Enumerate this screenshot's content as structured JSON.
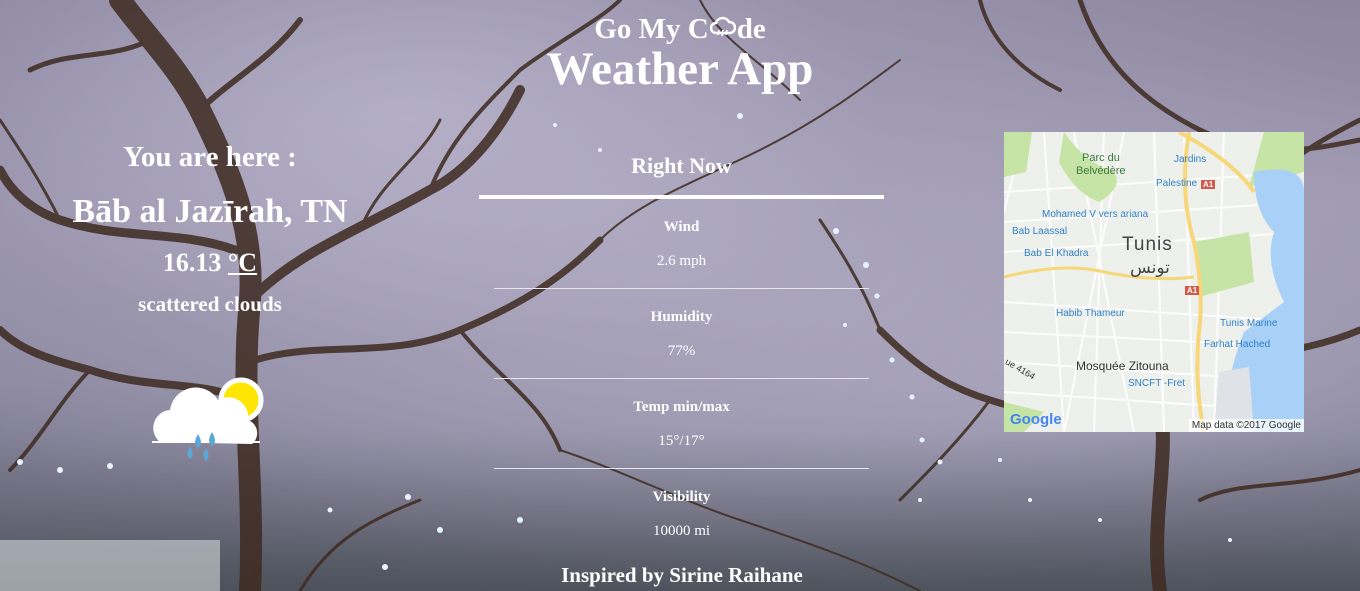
{
  "header": {
    "brand_sub_before": "Go My C",
    "brand_sub_after": "de",
    "brand_icon": "cloud-rain-icon",
    "app_title": "Weather App"
  },
  "location": {
    "label": "You are here :",
    "city": "Bāb al Jazīrah, TN",
    "temperature": "16.13",
    "unit": "°C",
    "description": "scattered clouds",
    "weather_icon": "cloud-sun-rain-icon"
  },
  "right_now": {
    "title": "Right Now",
    "metrics": [
      {
        "label": "Wind",
        "value": "2.6 mph"
      },
      {
        "label": "Humidity",
        "value": "77%"
      },
      {
        "label": "Temp min/max",
        "value": "15°/17°"
      },
      {
        "label": "Visibility",
        "value": "10000 mi"
      }
    ]
  },
  "map": {
    "labels": {
      "parc1": "Parc du",
      "parc2": "Belvédère",
      "jardins": "Jardins",
      "palestine": "Palestine",
      "mohamed": "Mohamed V vers ariana",
      "babLaassal": "Bab Laassal",
      "babElKhadra": "Bab El Khadra",
      "tunis": "Tunis",
      "tunisAr": "تونس",
      "a1a": "A1",
      "a1b": "A1",
      "habib": "Habib Thameur",
      "tunisMarine": "Tunis Marine",
      "farhat": "Farhat Hached",
      "mosque": "Mosquée Zitouna",
      "sncft": "SNCFT -Fret",
      "road4164": "ue 4164",
      "google": "Google",
      "credit": "Map data ©2017 Google"
    },
    "colors": {
      "water": "#a9d1f7",
      "park": "#c6e4a6",
      "land": "#eef0ec",
      "highway": "#f7d77a"
    }
  },
  "footer": {
    "text": "Inspired by Sirine Raihane"
  }
}
